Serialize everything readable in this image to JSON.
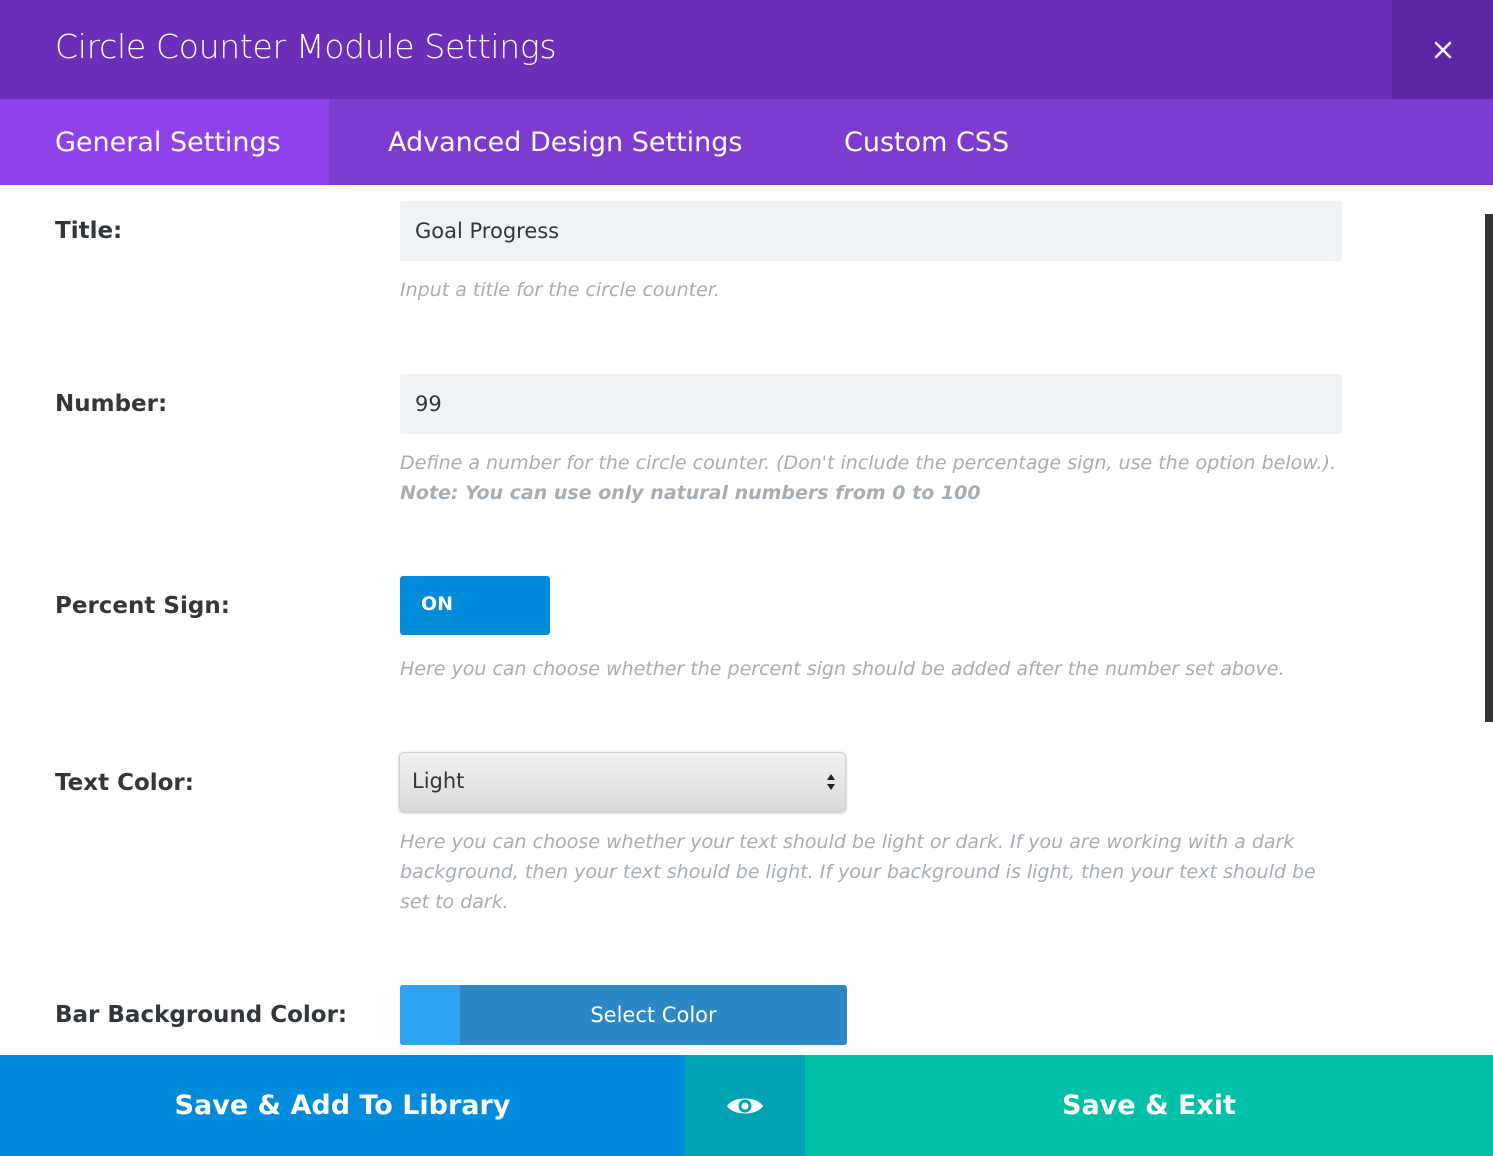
{
  "header": {
    "title": "Circle Counter Module Settings",
    "close_icon": "close-icon"
  },
  "tabs": [
    {
      "label": "General Settings",
      "active": true
    },
    {
      "label": "Advanced Design Settings",
      "active": false
    },
    {
      "label": "Custom CSS",
      "active": false
    }
  ],
  "fields": {
    "title": {
      "label": "Title:",
      "value": "Goal Progress",
      "description": "Input a title for the circle counter."
    },
    "number": {
      "label": "Number:",
      "value": "99",
      "description": "Define a number for the circle counter. (Don't include the percentage sign, use the option below.).",
      "note": "Note: You can use only natural numbers from 0 to 100"
    },
    "percent_sign": {
      "label": "Percent Sign:",
      "state": "ON",
      "description": "Here you can choose whether the percent sign should be added after the number set above."
    },
    "text_color": {
      "label": "Text Color:",
      "selected": "Light",
      "description_lines": [
        "Here you can choose whether your text should be light or dark. If you are working with a dark",
        "background, then your text should be light. If your background is light, then your text should be",
        "set to dark."
      ]
    },
    "bar_background_color": {
      "label": "Bar Background Color:",
      "button_label": "Select Color",
      "swatch_color": "#2ea3f2"
    }
  },
  "footer": {
    "save_library_label": "Save & Add To Library",
    "preview_icon": "eye-icon",
    "save_exit_label": "Save & Exit"
  },
  "colors": {
    "header": "#6c2eb9",
    "tabs": "#7e3bd0",
    "active_tab": "#8f42ec",
    "toggle": "#008bdb",
    "save_library": "#008bdb",
    "preview": "#00a3b6",
    "save_exit": "#00c1a8"
  }
}
